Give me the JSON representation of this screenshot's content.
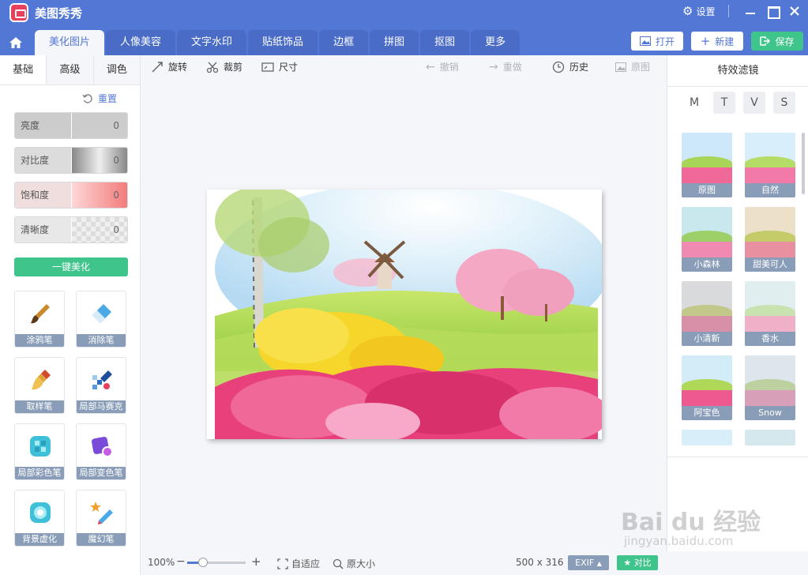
{
  "app": {
    "title": "美图秀秀",
    "settings_label": "设置"
  },
  "tabs": [
    {
      "label": "美化图片"
    },
    {
      "label": "人像美容"
    },
    {
      "label": "文字水印"
    },
    {
      "label": "贴纸饰品"
    },
    {
      "label": "边框"
    },
    {
      "label": "拼图"
    },
    {
      "label": "抠图"
    },
    {
      "label": "更多"
    }
  ],
  "actions": {
    "open": "打开",
    "new": "新建",
    "save": "保存"
  },
  "left": {
    "subtabs": [
      "基础",
      "高级",
      "调色"
    ],
    "reset": "重置",
    "sliders": [
      {
        "label": "亮度",
        "value": "0"
      },
      {
        "label": "对比度",
        "value": "0"
      },
      {
        "label": "饱和度",
        "value": "0"
      },
      {
        "label": "清晰度",
        "value": "0"
      }
    ],
    "one_key": "一键美化",
    "tools": [
      "涂鸦笔",
      "消除笔",
      "取样笔",
      "局部马赛克",
      "局部彩色笔",
      "局部变色笔",
      "背景虚化",
      "魔幻笔"
    ]
  },
  "toolbar": {
    "rotate": "旋转",
    "crop": "裁剪",
    "size": "尺寸",
    "undo": "撤销",
    "redo": "重做",
    "history": "历史",
    "original": "原图"
  },
  "status": {
    "zoom": "100%",
    "fit": "自适应",
    "actual": "原大小",
    "dimensions": "500 x 316",
    "exif": "EXIF",
    "compare": "对比"
  },
  "right": {
    "title": "特效滤镜",
    "filter_tabs": [
      "M",
      "T",
      "V",
      "S"
    ],
    "filters": [
      "原图",
      "自然",
      "小森林",
      "甜美可人",
      "小清新",
      "香水",
      "阿宝色",
      "Snow"
    ]
  },
  "watermark": {
    "main": "Bai du 经验",
    "sub": "jingyan.baidu.com"
  },
  "colors": {
    "brand": "#5377d4",
    "accent_green": "#3fc48c",
    "label_gray": "#8a9db8"
  }
}
